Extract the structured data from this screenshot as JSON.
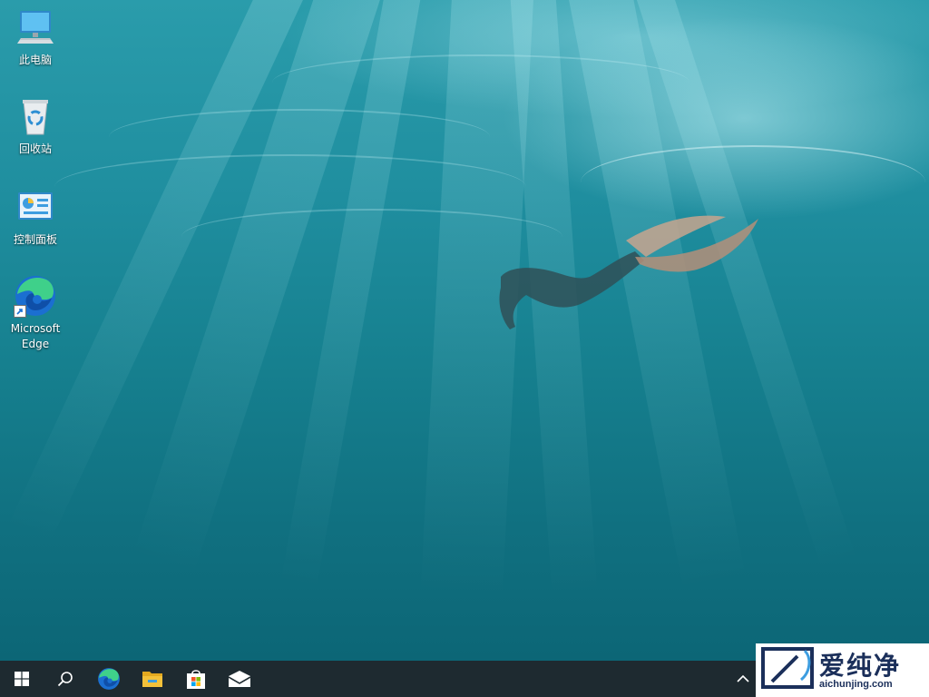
{
  "desktop": {
    "icons": [
      {
        "label": "此电脑",
        "icon": "computer-icon"
      },
      {
        "label": "回收站",
        "icon": "recycle-bin-icon"
      },
      {
        "label": "控制面板",
        "icon": "control-panel-icon"
      },
      {
        "label": "Microsoft Edge",
        "icon": "edge-icon"
      }
    ]
  },
  "taskbar": {
    "items": [
      "start-button",
      "search-button",
      "edge-button",
      "file-explorer-button",
      "store-button",
      "mail-button"
    ],
    "tray_chevron": "chevron-up-icon"
  },
  "watermark": {
    "brand": "爱纯净",
    "url": "aichunjing.com"
  },
  "colors": {
    "taskbar": "#1e2a30",
    "water": "#1a8a9b",
    "edge_blue": "#1b6fd1",
    "edge_green": "#3fd08a",
    "folder": "#f3c13a",
    "watermark_text": "#1b2f5a"
  }
}
